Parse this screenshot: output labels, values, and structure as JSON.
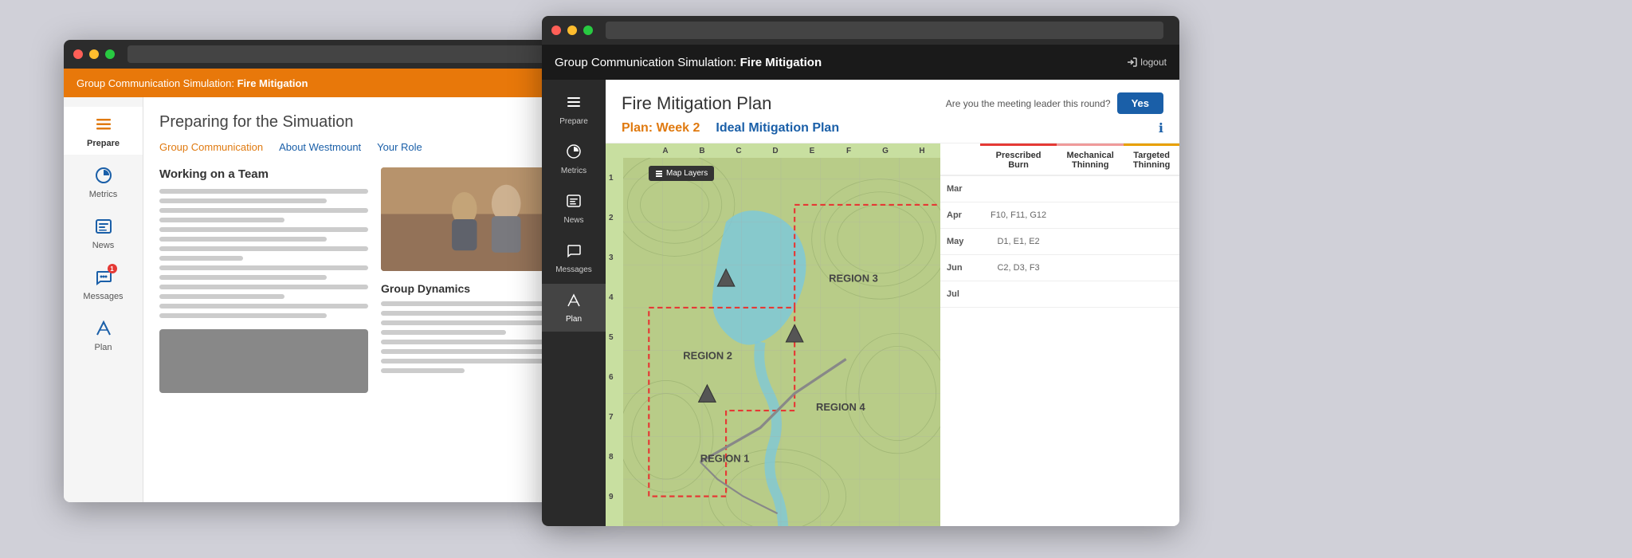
{
  "window1": {
    "titlebar": {
      "address_placeholder": ""
    },
    "topbar": {
      "title_prefix": "Group Communication Simulation: ",
      "title_bold": "Fire Mitigation"
    },
    "sidebar": {
      "items": [
        {
          "id": "prepare",
          "label": "Prepare",
          "active": true,
          "icon": "menu-icon"
        },
        {
          "id": "metrics",
          "label": "Metrics",
          "active": false,
          "icon": "chart-icon"
        },
        {
          "id": "news",
          "label": "News",
          "active": false,
          "icon": "news-icon"
        },
        {
          "id": "messages",
          "label": "Messages",
          "active": false,
          "icon": "messages-icon",
          "badge": "1"
        },
        {
          "id": "plan",
          "label": "Plan",
          "active": false,
          "icon": "plan-icon"
        }
      ]
    },
    "main": {
      "page_title": "Preparing for the Simuation",
      "nav_tabs": [
        {
          "label": "Group Communication",
          "active": true
        },
        {
          "label": "About Westmount",
          "active": false
        },
        {
          "label": "Your Role",
          "active": false
        }
      ],
      "section1_title": "Working on a Team",
      "section2_title": "Group Dynamics"
    }
  },
  "window2": {
    "titlebar": {
      "address_placeholder": ""
    },
    "topbar": {
      "title_prefix": "Group Communication Simulation: ",
      "title_bold": "Fire Mitigation",
      "logout_label": "logout"
    },
    "sidebar": {
      "items": [
        {
          "id": "prepare",
          "label": "Prepare",
          "active": false,
          "icon": "menu-icon"
        },
        {
          "id": "metrics",
          "label": "Metrics",
          "active": false,
          "icon": "chart-icon"
        },
        {
          "id": "news",
          "label": "News",
          "active": false,
          "icon": "news-icon"
        },
        {
          "id": "messages",
          "label": "Messages",
          "active": false,
          "icon": "messages-icon"
        },
        {
          "id": "plan",
          "label": "Plan",
          "active": true,
          "icon": "plan-icon"
        }
      ]
    },
    "main": {
      "page_title": "Fire Mitigation Plan",
      "meeting_question": "Are you the meeting leader this round?",
      "yes_button": "Yes",
      "plan_week": "Plan: Week 2",
      "ideal_plan": "Ideal Mitigation Plan",
      "map_layers_btn": "Map Layers",
      "col_labels": [
        "A",
        "B",
        "C",
        "D",
        "E",
        "F",
        "G",
        "H"
      ],
      "row_labels": [
        "1",
        "2",
        "3",
        "4",
        "5",
        "6",
        "7",
        "8",
        "9"
      ],
      "regions": [
        "REGION 1",
        "REGION 2",
        "REGION 3",
        "REGION 4"
      ],
      "table": {
        "columns": [
          "",
          "Prescribed Burn",
          "Mechanical Thinning",
          "Targeted Thinning"
        ],
        "rows": [
          {
            "month": "Mar",
            "prescribed": "",
            "mechanical": "",
            "targeted": ""
          },
          {
            "month": "Apr",
            "prescribed": "F10, F11, G12",
            "mechanical": "",
            "targeted": ""
          },
          {
            "month": "May",
            "prescribed": "D1, E1, E2",
            "mechanical": "",
            "targeted": ""
          },
          {
            "month": "Jun",
            "prescribed": "C2, D3, F3",
            "mechanical": "",
            "targeted": ""
          },
          {
            "month": "Jul",
            "prescribed": "",
            "mechanical": "",
            "targeted": ""
          }
        ]
      }
    }
  }
}
